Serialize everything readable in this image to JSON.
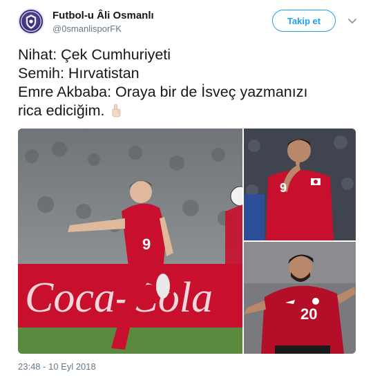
{
  "account": {
    "display_name": "Futbol-u Âli Osmanlı",
    "handle": "@0smanlisporFK",
    "avatar_icon": "club-crest-icon"
  },
  "actions": {
    "follow_label": "Takip et",
    "more_icon": "chevron-down-icon"
  },
  "tweet": {
    "lines": [
      "Nihat: Çek Cumhuriyeti",
      "Semih: Hırvatistan",
      "Emre Akbaba: Oraya bir de İsveç yazmanızı",
      "rica ediciğim."
    ],
    "emoji_icon": "index-pointing-up-emoji-icon"
  },
  "media": {
    "photos": [
      {
        "kind": "football-player-photo",
        "shirt_number": "9"
      },
      {
        "kind": "football-player-photo",
        "shirt_number": "9"
      },
      {
        "kind": "football-player-photo",
        "shirt_number": "20"
      }
    ],
    "banner_text": "Coca-Cola"
  },
  "timestamp": "23:48 - 10 Eyl 2018",
  "colors": {
    "accent": "#1da1f2",
    "muted": "#657786",
    "text": "#14171a",
    "kit_red": "#c8102e"
  }
}
